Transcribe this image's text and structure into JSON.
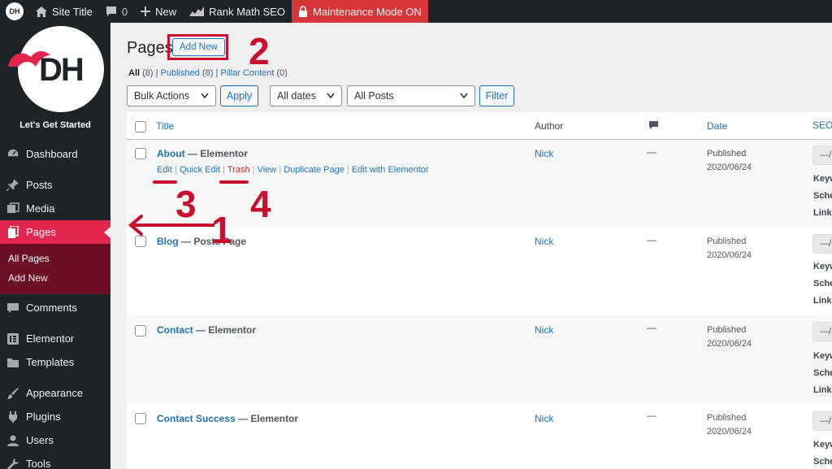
{
  "adminbar": {
    "logo_text": "DH",
    "site_title": "Site Title",
    "comments_count": "0",
    "new_label": "New",
    "rankmath_label": "Rank Math SEO",
    "maintenance_label": "Maintenance Mode ON"
  },
  "sidebar": {
    "logo_text": "DH",
    "tagline": "Let's Get Started",
    "items": {
      "dashboard": "Dashboard",
      "posts": "Posts",
      "media": "Media",
      "pages": "Pages",
      "all_pages": "All Pages",
      "add_new": "Add New",
      "comments": "Comments",
      "elementor": "Elementor",
      "templates": "Templates",
      "appearance": "Appearance",
      "plugins": "Plugins",
      "users": "Users",
      "tools": "Tools"
    }
  },
  "header": {
    "title": "Pages",
    "add_new": "Add New"
  },
  "filters": {
    "all": "All",
    "all_count": "(8)",
    "published": "Published",
    "published_count": "(8)",
    "pillar": "Pillar Content",
    "pillar_count": "(0)",
    "sep": "|",
    "bulk_actions": "Bulk Actions",
    "apply": "Apply",
    "all_dates": "All dates",
    "all_posts": "All Posts",
    "filter": "Filter"
  },
  "table": {
    "columns": {
      "title": "Title",
      "author": "Author",
      "date": "Date",
      "seo": "SEO"
    },
    "rows": [
      {
        "title": "About",
        "state": "— Elementor",
        "author": "Nick",
        "comments": "—",
        "status": "Published",
        "date": "2020/06/24",
        "seo": "—/",
        "kw": "Keyw",
        "schema": "Sche",
        "links": "Links"
      },
      {
        "title": "Blog",
        "state": "— Posts Page",
        "author": "Nick",
        "comments": "—",
        "status": "Published",
        "date": "2020/06/24",
        "seo": "—/",
        "kw": "Keyw",
        "schema": "Sche",
        "links": "Links"
      },
      {
        "title": "Contact",
        "state": "— Elementor",
        "author": "Nick",
        "comments": "—",
        "status": "Published",
        "date": "2020/06/24",
        "seo": "—/",
        "kw": "Keyw",
        "schema": "Sche",
        "links": "Links"
      },
      {
        "title": "Contact Success",
        "state": "— Elementor",
        "author": "Nick",
        "comments": "—",
        "status": "Published",
        "date": "2020/06/24",
        "seo": "—/",
        "kw": "Keyw",
        "schema": "Sche",
        "links": ""
      }
    ],
    "row_actions": {
      "edit": "Edit",
      "quick_edit": "Quick Edit",
      "trash": "Trash",
      "view": "View",
      "duplicate": "Duplicate Page",
      "elementor": "Edit with Elementor",
      "sep": "|"
    }
  },
  "annotations": {
    "one": "1",
    "two": "2",
    "three": "3",
    "four": "4"
  },
  "colors": {
    "accent": "#e3264e",
    "annotation": "#c8102e",
    "link": "#2271b1",
    "sidebar": "#1d2327"
  }
}
